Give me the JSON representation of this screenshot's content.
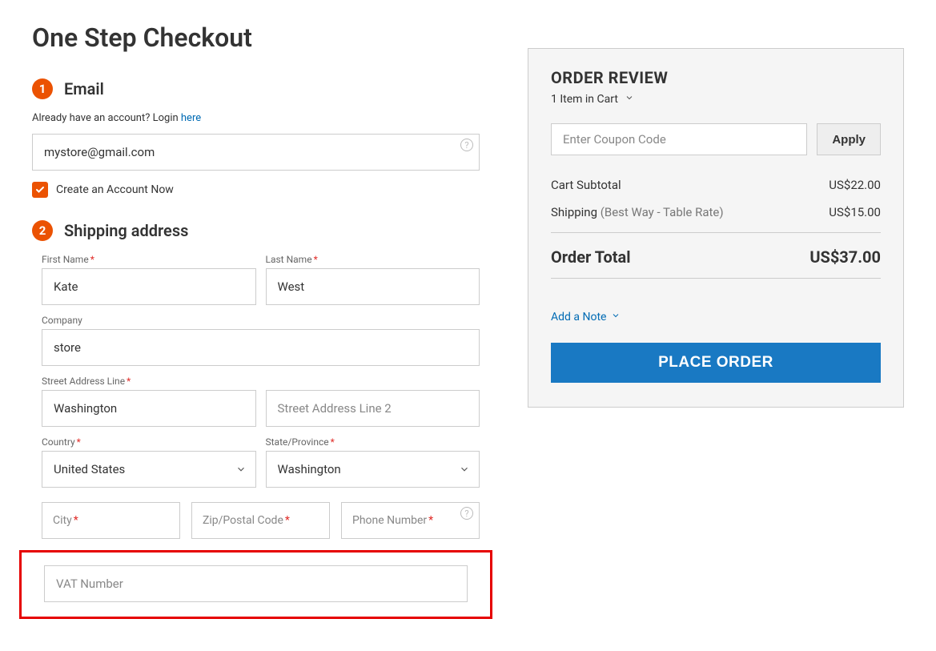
{
  "page_title": "One Step Checkout",
  "steps": {
    "email": {
      "num": "1",
      "title": "Email"
    },
    "shipping": {
      "num": "2",
      "title": "Shipping address"
    }
  },
  "login": {
    "text": "Already have an account? Login ",
    "link_text": "here"
  },
  "email_field": {
    "value": "mystore@gmail.com"
  },
  "create_account_label": "Create an Account Now",
  "shipping": {
    "first_name": {
      "label": "First Name",
      "value": "Kate"
    },
    "last_name": {
      "label": "Last Name",
      "value": "West"
    },
    "company": {
      "label": "Company",
      "value": "store"
    },
    "street1": {
      "label": "Street Address Line",
      "value": "Washington"
    },
    "street2": {
      "placeholder": "Street Address Line 2",
      "value": ""
    },
    "country": {
      "label": "Country",
      "value": "United States"
    },
    "state": {
      "label": "State/Province",
      "value": "Washington"
    },
    "city": {
      "placeholder": "City",
      "value": ""
    },
    "zip": {
      "placeholder": "Zip/Postal Code",
      "value": ""
    },
    "phone": {
      "placeholder": "Phone Number",
      "value": ""
    },
    "vat": {
      "placeholder": "VAT Number",
      "value": ""
    }
  },
  "review": {
    "title": "ORDER REVIEW",
    "cart_summary": "1 Item in Cart",
    "coupon_placeholder": "Enter Coupon Code",
    "apply_label": "Apply",
    "subtotal_label": "Cart Subtotal",
    "subtotal_value": "US$22.00",
    "shipping_label": "Shipping",
    "shipping_method": " (Best Way - Table Rate)",
    "shipping_value": "US$15.00",
    "total_label": "Order Total",
    "total_value": "US$37.00",
    "note_label": "Add a Note",
    "place_order_label": "PLACE ORDER"
  }
}
